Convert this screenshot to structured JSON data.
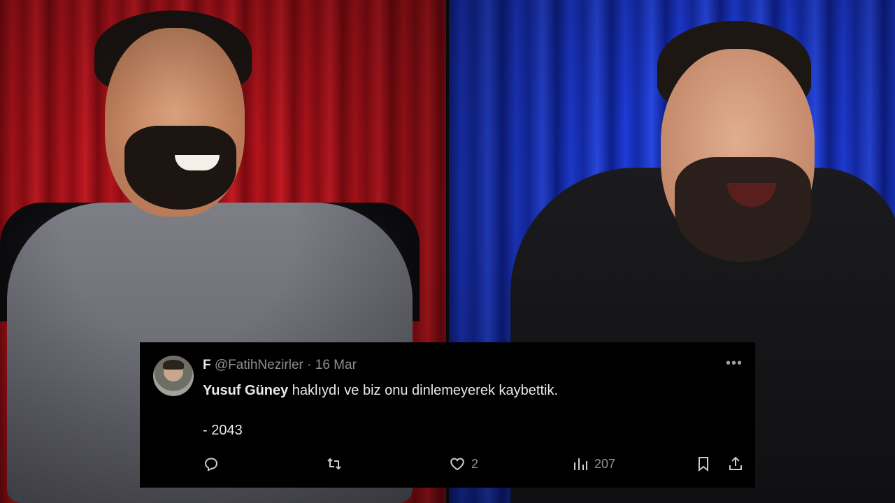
{
  "tweet": {
    "display_name": "F",
    "handle": "@FatihNezirler",
    "separator": "·",
    "date": "16 Mar",
    "more_label": "•••",
    "text_mention": "Yusuf Güney",
    "text_rest": " haklıydı ve biz onu dinlemeyerek kaybettik.",
    "signature": "- 2043",
    "actions": {
      "reply": {
        "icon": "reply-icon",
        "count": ""
      },
      "retweet": {
        "icon": "retweet-icon",
        "count": ""
      },
      "like": {
        "icon": "heart-icon",
        "count": "2"
      },
      "views": {
        "icon": "views-icon",
        "count": "207"
      },
      "bookmark": {
        "icon": "bookmark-icon"
      },
      "share": {
        "icon": "share-icon"
      }
    }
  },
  "colors": {
    "card_bg": "#000000",
    "text_primary": "#e7e9ea",
    "text_secondary": "#8b9096",
    "left_backdrop": "#b3141c",
    "right_backdrop": "#1e3bd6"
  }
}
